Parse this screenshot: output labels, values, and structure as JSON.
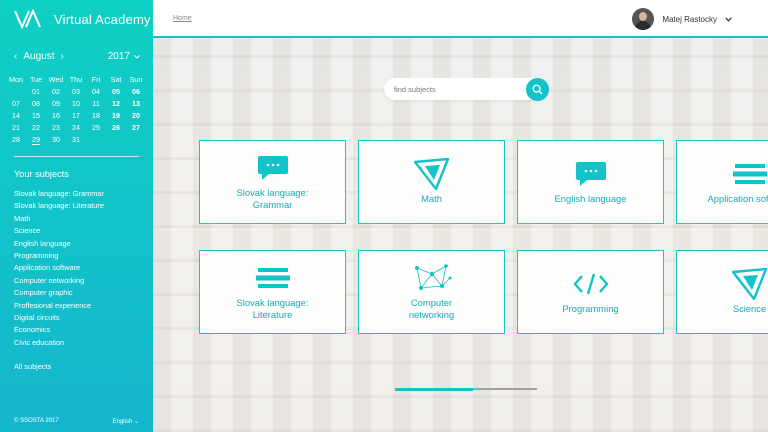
{
  "app": {
    "name": "Virtual Academy"
  },
  "breadcrumb": {
    "home": "Home"
  },
  "user": {
    "name": "Matej Rastocky",
    "menu_icon": "chevron-down-icon"
  },
  "calendar": {
    "month": "August",
    "year": "2017",
    "weekdays": [
      "Mon",
      "Tue",
      "Wed",
      "Thu",
      "Fri",
      "Sat",
      "Sun"
    ],
    "weeks": [
      [
        "",
        "01",
        "02",
        "03",
        "04",
        "05",
        "06"
      ],
      [
        "07",
        "08",
        "09",
        "10",
        "11",
        "12",
        "13"
      ],
      [
        "14",
        "15",
        "16",
        "17",
        "18",
        "19",
        "20"
      ],
      [
        "21",
        "22",
        "23",
        "24",
        "25",
        "26",
        "27"
      ],
      [
        "28",
        "29",
        "30",
        "31",
        "",
        "",
        ""
      ]
    ],
    "today": "29"
  },
  "sidebar": {
    "subjects_title": "Your subjects",
    "subjects": [
      "Slovak language: Grammar",
      "Slovak language: Literature",
      "Math",
      "Science",
      "English language",
      "Programming",
      "Application software",
      "Computer networking",
      "Computer graphic",
      "Proffesional experience",
      "Digital circuits",
      "Economics",
      "Civic education"
    ],
    "all_subjects": "All subjects",
    "copyright": "© SSOSTA 2017",
    "language": "English"
  },
  "search": {
    "placeholder": "find subjects"
  },
  "cards": [
    {
      "label": "Slovak language: Grammar",
      "icon": "chat-bubble-icon"
    },
    {
      "label": "Math",
      "icon": "triangle-ruler-icon"
    },
    {
      "label": "English language",
      "icon": "chat-bubble-icon"
    },
    {
      "label": "Application software",
      "icon": "stacked-bars-icon"
    },
    {
      "label": "Slovak language: Literature",
      "icon": "stacked-bars-icon"
    },
    {
      "label": "Computer networking",
      "icon": "network-graph-icon"
    },
    {
      "label": "Programming",
      "icon": "code-brackets-icon"
    },
    {
      "label": "Science",
      "icon": "triangle-ruler-icon"
    }
  ],
  "carousel": {
    "progress": 0.55
  },
  "colors": {
    "accent": "#12c3c9",
    "text_accent": "#1aa9b4"
  }
}
